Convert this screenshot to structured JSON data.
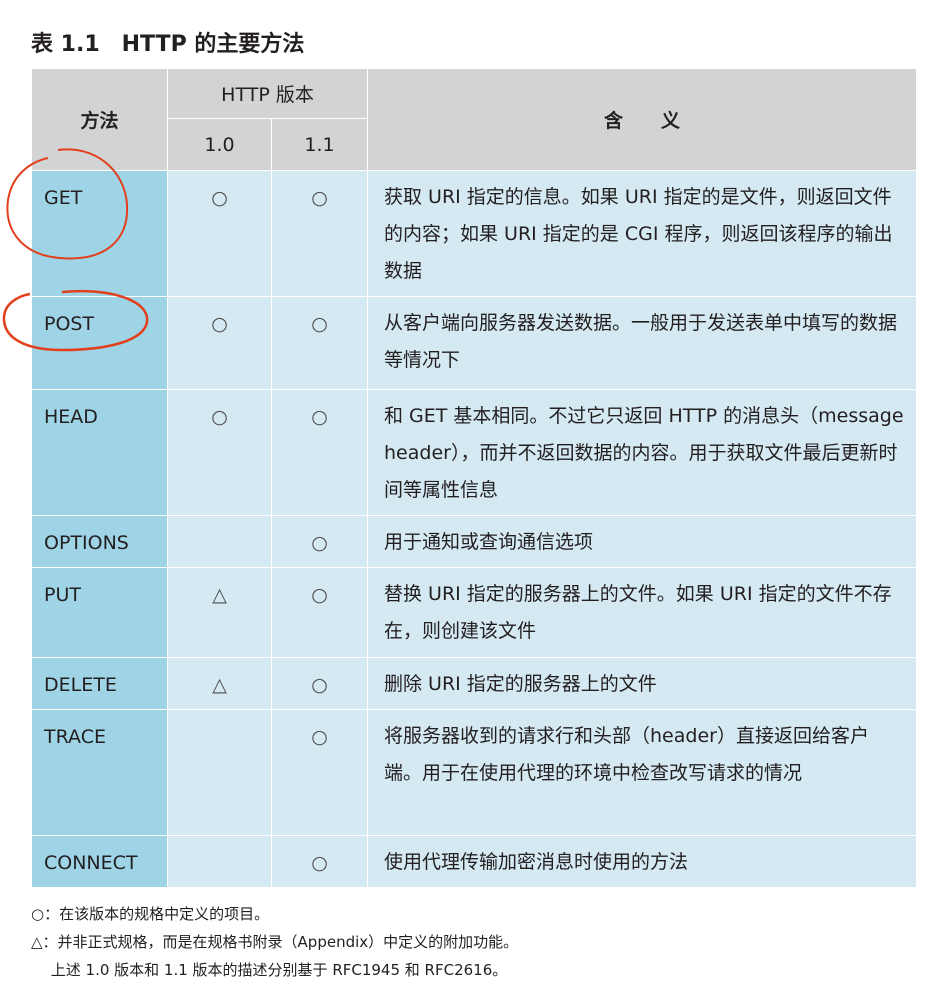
{
  "title": "表 1.1　HTTP 的主要方法",
  "header": {
    "method": "方法",
    "version_group": "HTTP 版本",
    "v10": "1.0",
    "v11": "1.1",
    "meaning": "含　　义"
  },
  "rows": [
    {
      "method": "GET",
      "v10": "○",
      "v11": "○",
      "desc": "获取 URI 指定的信息。如果 URI 指定的是文件，则返回文件的内容；如果 URI 指定的是 CGI 程序，则返回该程序的输出数据"
    },
    {
      "method": "POST",
      "v10": "○",
      "v11": "○",
      "desc": "从客户端向服务器发送数据。一般用于发送表单中填写的数据等情况下"
    },
    {
      "method": "HEAD",
      "v10": "○",
      "v11": "○",
      "desc": "和 GET 基本相同。不过它只返回 HTTP 的消息头（message header），而并不返回数据的内容。用于获取文件最后更新时间等属性信息"
    },
    {
      "method": "OPTIONS",
      "v10": "",
      "v11": "○",
      "desc": "用于通知或查询通信选项"
    },
    {
      "method": "PUT",
      "v10": "△",
      "v11": "○",
      "desc": "替换 URI 指定的服务器上的文件。如果 URI 指定的文件不存在，则创建该文件"
    },
    {
      "method": "DELETE",
      "v10": "△",
      "v11": "○",
      "desc": "删除 URI 指定的服务器上的文件"
    },
    {
      "method": "TRACE",
      "v10": "",
      "v11": "○",
      "desc": "将服务器收到的请求行和头部（header）直接返回给客户端。用于在使用代理的环境中检查改写请求的情况"
    },
    {
      "method": "CONNECT",
      "v10": "",
      "v11": "○",
      "desc": "使用代理传输加密消息时使用的方法"
    }
  ],
  "notes": {
    "circle": "○：在该版本的规格中定义的项目。",
    "triangle": "△：并非正式规格，而是在规格书附录（Appendix）中定义的附加功能。",
    "source": "　 上述 1.0 版本和 1.1 版本的描述分别基于 RFC1945 和 RFC2616。"
  },
  "annotation_color": "#e2401c"
}
